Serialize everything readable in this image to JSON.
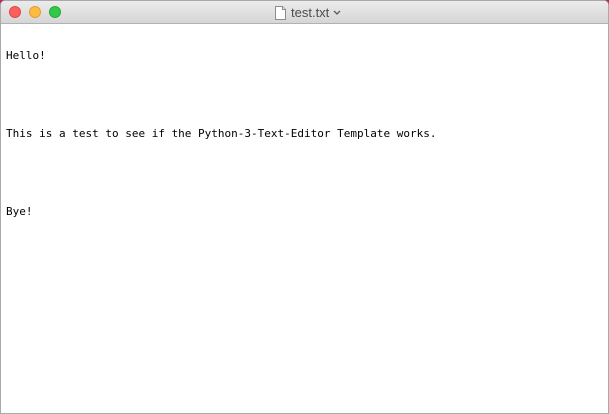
{
  "window": {
    "title": "test.txt"
  },
  "icons": {
    "close": "close-button",
    "minimize": "minimize-button",
    "zoom": "zoom-button",
    "document": "document-icon",
    "chevron": "chevron-down-icon"
  },
  "editor": {
    "lines": [
      "Hello!",
      "",
      "This is a test to see if the Python-3-Text-Editor Template works.",
      "",
      "Bye!"
    ]
  },
  "colors": {
    "desktop_background": "#b8235e",
    "close": "#fc605c",
    "minimize": "#fdbc40",
    "zoom": "#34c84a"
  }
}
